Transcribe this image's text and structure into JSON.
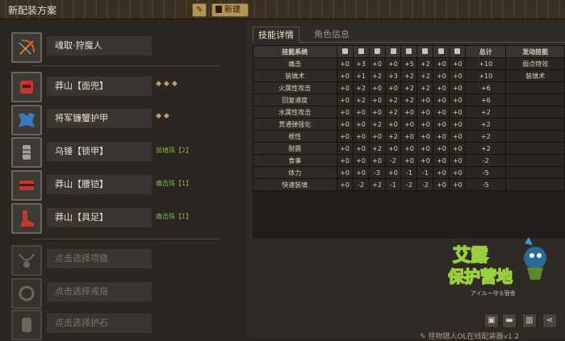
{
  "window": {
    "title": "新配装方案"
  },
  "toolbar": {
    "edit_icon": "pencil-icon",
    "new_label": "新建"
  },
  "equipment": {
    "weapon": {
      "name": "魂取·狩魔人"
    },
    "head": {
      "name": "莽山【面兜】",
      "slots": "◆◆◆"
    },
    "chest": {
      "name": "将军镰蟹护甲",
      "slots": "◆◆"
    },
    "arms": {
      "name": "乌锤【锁甲】",
      "jewel": "装填珠【2】"
    },
    "waist": {
      "name": "莽山【腰铠】",
      "jewel": "痛击珠【1】"
    },
    "legs": {
      "name": "莽山【具足】",
      "jewel": "痛击珠【1】"
    },
    "charm_placeholder": "点击选择项链",
    "ring_placeholder": "点击选择戒指",
    "stone_placeholder": "点击选择护石"
  },
  "tabs": {
    "skills": "技能详情",
    "char": "角色信息"
  },
  "skills_table": {
    "header_skill": "技能系统",
    "header_total": "总计",
    "header_active": "发动技能",
    "rows": [
      {
        "name": "痛击",
        "v": [
          "+0",
          "+3",
          "+0",
          "+0",
          "+5",
          "+2",
          "+0",
          "+0"
        ],
        "total": "+10",
        "active": "弱点特效"
      },
      {
        "name": "装填术",
        "v": [
          "+0",
          "+1",
          "+2",
          "+3",
          "+2",
          "+2",
          "+0",
          "+0"
        ],
        "total": "+10",
        "active": "装填术"
      },
      {
        "name": "火属性攻击",
        "v": [
          "+0",
          "+2",
          "+0",
          "+0",
          "+2",
          "+2",
          "+0",
          "+0"
        ],
        "total": "+6",
        "active": ""
      },
      {
        "name": "回复速度",
        "v": [
          "+0",
          "+2",
          "+0",
          "+2",
          "+2",
          "+0",
          "+0",
          "+0"
        ],
        "total": "+6",
        "active": ""
      },
      {
        "name": "水属性攻击",
        "v": [
          "+0",
          "+0",
          "+0",
          "+2",
          "+0",
          "+0",
          "+0",
          "+0"
        ],
        "total": "+2",
        "active": ""
      },
      {
        "name": "贯通弹强化",
        "v": [
          "+0",
          "+0",
          "+2",
          "+0",
          "+0",
          "+0",
          "+0",
          "+0"
        ],
        "total": "+2",
        "active": ""
      },
      {
        "name": "根性",
        "v": [
          "+0",
          "+0",
          "+0",
          "+2",
          "+0",
          "+0",
          "+0",
          "+0"
        ],
        "total": "+2",
        "active": ""
      },
      {
        "name": "耐震",
        "v": [
          "+0",
          "+0",
          "+2",
          "+0",
          "+0",
          "+0",
          "+0",
          "+0"
        ],
        "total": "+2",
        "active": ""
      },
      {
        "name": "食事",
        "v": [
          "+0",
          "+0",
          "+0",
          "-2",
          "+0",
          "+0",
          "+0",
          "+0"
        ],
        "total": "-2",
        "active": ""
      },
      {
        "name": "体力",
        "v": [
          "+0",
          "+0",
          "-3",
          "+0",
          "-1",
          "-1",
          "+0",
          "+0"
        ],
        "total": "-5",
        "active": ""
      },
      {
        "name": "快速装填",
        "v": [
          "+0",
          "-2",
          "+2",
          "-1",
          "-2",
          "-2",
          "+0",
          "+0"
        ],
        "total": "-5",
        "active": ""
      }
    ]
  },
  "logo": {
    "line1": "艾露",
    "line2": "保护营地",
    "subtitle": "アイルー守る宿舎"
  },
  "bottom": {
    "note": "怪物猎人OL在线配装器v1.2"
  }
}
